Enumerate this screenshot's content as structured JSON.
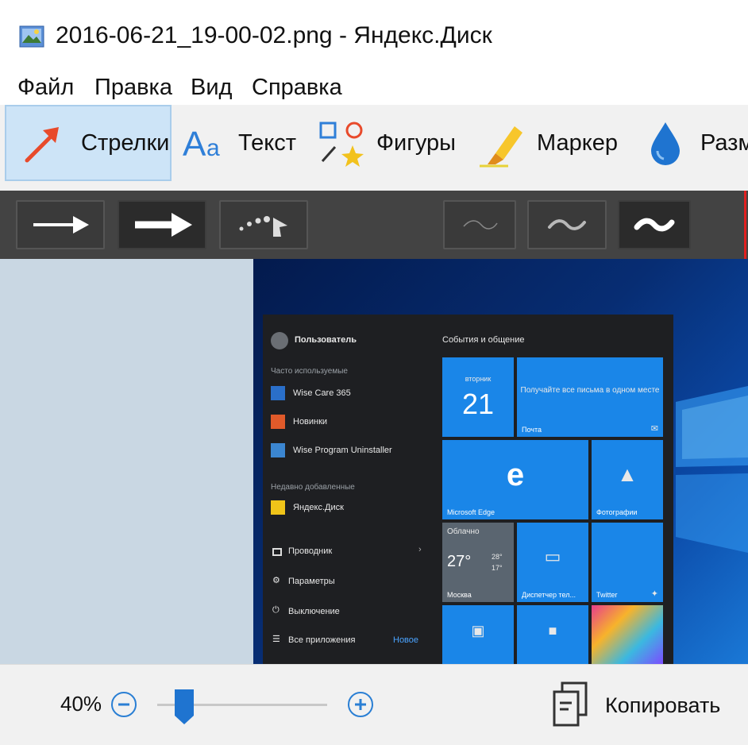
{
  "window": {
    "title": "2016-06-21_19-00-02.png - Яндекс.Диск"
  },
  "menu": {
    "items": [
      "Файл",
      "Правка",
      "Вид",
      "Справка"
    ]
  },
  "toolbar": {
    "tools": [
      {
        "label": "Стрелки",
        "icon": "arrow-icon",
        "active": true
      },
      {
        "label": "Текст",
        "icon": "text-icon",
        "active": false
      },
      {
        "label": "Фигуры",
        "icon": "shapes-icon",
        "active": false
      },
      {
        "label": "Маркер",
        "icon": "marker-icon",
        "active": false
      },
      {
        "label": "Разм",
        "icon": "blur-drop-icon",
        "active": false
      }
    ]
  },
  "options": {
    "arrow_styles": [
      "thin-arrow",
      "thick-arrow",
      "dotted-arrow"
    ],
    "line_widths": [
      "thin",
      "medium",
      "thick"
    ],
    "selected_line_width": "thick"
  },
  "screenshot": {
    "user_name": "Пользователь",
    "most_used_heading": "Часто используемые",
    "most_used": [
      "Wise Care 365",
      "Новинки",
      "Wise Program Uninstaller"
    ],
    "recent_heading": "Недавно добавленные",
    "recent": [
      "Яндекс.Диск"
    ],
    "bottom_items": [
      "Проводник",
      "Параметры",
      "Выключение",
      "Все приложения"
    ],
    "bottom_extra": "Новое",
    "tiles_heading": "События и общение",
    "tiles": {
      "calendar_day": "вторник",
      "calendar_date": "21",
      "mail_text": "Получайте все письма в одном месте",
      "mail_label": "Почта",
      "edge_label": "Microsoft Edge",
      "photos_label": "Фотографии",
      "weather_city": "Москва",
      "weather_title": "Облачно",
      "weather_temp": "27°",
      "weather_high": "28°",
      "weather_low": "17°",
      "remote_label": "Диспетчер тел...",
      "twitter_label": "Twitter"
    }
  },
  "status": {
    "zoom": "40%",
    "zoom_level": 0.16,
    "copy_label": "Копировать"
  },
  "colors": {
    "accent": "#2a7fd4",
    "active_tool_bg": "#cde4f7",
    "options_bar": "#434343",
    "tile_blue": "#1a86e8"
  }
}
